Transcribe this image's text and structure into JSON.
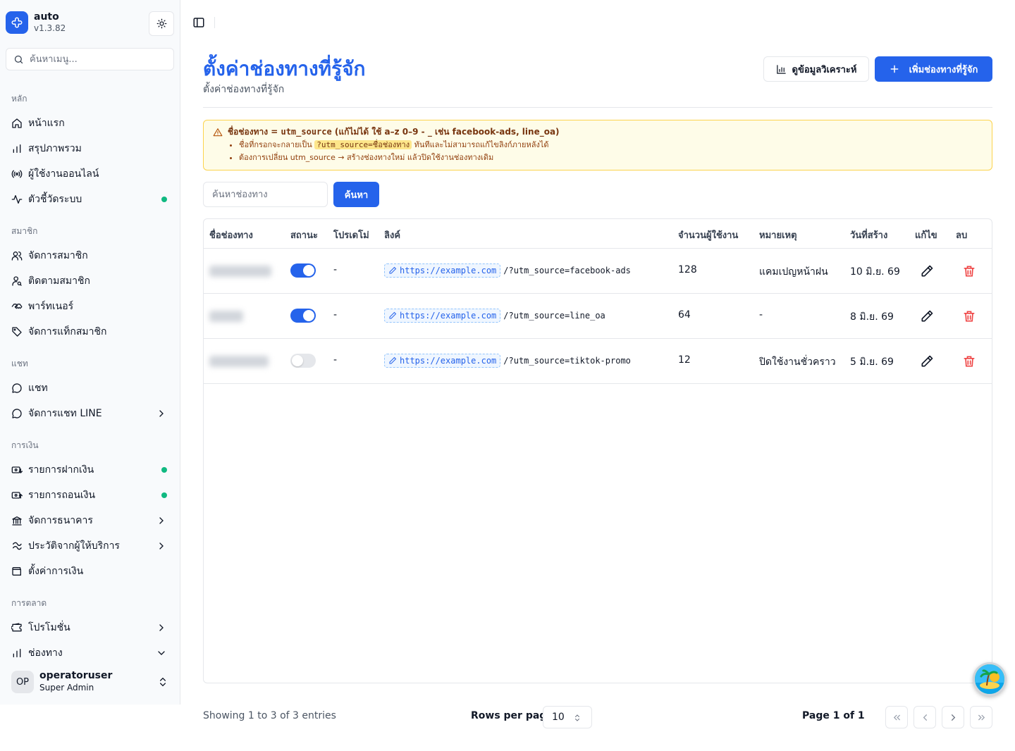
{
  "app": {
    "name": "auto",
    "version": "v1.3.82"
  },
  "sidebar": {
    "search_placeholder": "ค้นหาเมนู...",
    "groups": [
      {
        "label": "หลัก",
        "items": [
          {
            "label": "หน้าแรก",
            "icon": "home-icon"
          },
          {
            "label": "สรุปภาพรวม",
            "icon": "bar-chart-icon"
          },
          {
            "label": "ผู้ใช้งานออนไลน์",
            "icon": "radio-icon"
          },
          {
            "label": "ตัวชี้วัดระบบ",
            "icon": "activity-icon",
            "status": "online"
          }
        ]
      },
      {
        "label": "สมาชิก",
        "items": [
          {
            "label": "จัดการสมาชิก",
            "icon": "users-icon"
          },
          {
            "label": "ติดตามสมาชิก",
            "icon": "user-search-icon"
          },
          {
            "label": "พาร์ทเนอร์",
            "icon": "handshake-icon"
          },
          {
            "label": "จัดการแท็กสมาชิก",
            "icon": "tag-icon"
          }
        ]
      },
      {
        "label": "แชท",
        "items": [
          {
            "label": "แชท",
            "icon": "chat-icon"
          },
          {
            "label": "จัดการแชท LINE",
            "icon": "chat-icon",
            "chevron": "right"
          }
        ]
      },
      {
        "label": "การเงิน",
        "items": [
          {
            "label": "รายการฝากเงิน",
            "icon": "deposit-icon",
            "status": "online"
          },
          {
            "label": "รายการถอนเงิน",
            "icon": "withdraw-icon",
            "status": "online"
          },
          {
            "label": "จัดการธนาคาร",
            "icon": "bank-icon",
            "chevron": "right"
          },
          {
            "label": "ประวัติจากผู้ให้บริการ",
            "icon": "transfer-icon",
            "chevron": "right"
          },
          {
            "label": "ตั้งค่าการเงิน",
            "icon": "wallet-icon"
          }
        ]
      },
      {
        "label": "การตลาด",
        "items": [
          {
            "label": "โปรโมชั่น",
            "icon": "ticket-icon",
            "chevron": "right"
          },
          {
            "label": "ช่องทาง",
            "icon": "bar-chart-icon",
            "chevron": "down"
          }
        ]
      }
    ],
    "user": {
      "initials": "OP",
      "name": "operatoruser",
      "role": "Super Admin"
    }
  },
  "page": {
    "title": "ตั้งค่าช่องทางที่รู้จัก",
    "subtitle": "ตั้งค่าช่องทางที่รู้จัก",
    "analytics_button": "ดูข้อมูลวิเคราะห์",
    "add_button": "เพิ่มช่องทางที่รู้จัก"
  },
  "alert": {
    "title_prefix": "ชื่อช่องทาง = ",
    "title_code": "utm_source",
    "title_suffix": " (แก้ไม่ได้ ใช้ a–z 0–9 - _ เช่น facebook-ads, line_oa)",
    "line1_prefix": "ชื่อที่กรอกจะกลายเป็น ",
    "line1_code": "?utm_source=ชื่อช่องทาง",
    "line1_suffix": " ทันทีและไม่สามารถแก้ไขลิงก์ภายหลังได้",
    "line2": "ต้องการเปลี่ยน utm_source → สร้างช่องทางใหม่ แล้วปิดใช้งานช่องทางเดิม"
  },
  "search": {
    "placeholder": "ค้นหาช่องทาง",
    "button": "ค้นหา"
  },
  "table": {
    "columns": [
      "ชื่อช่องทาง",
      "สถานะ",
      "โปรเดโม่",
      "ลิงค์",
      "จำนวนผู้ใช้งาน",
      "หมายเหตุ",
      "วันที่สร้าง",
      "แก้ไข",
      "ลบ"
    ],
    "rows": [
      {
        "active": true,
        "promo": "-",
        "base_url": "https://example.com",
        "path": "/?utm_source=facebook-ads",
        "users": "128",
        "note": "แคมเปญหน้าฝน",
        "created": "10 มิ.ย. 69"
      },
      {
        "active": true,
        "promo": "-",
        "base_url": "https://example.com",
        "path": "/?utm_source=line_oa",
        "users": "64",
        "note": "-",
        "created": "8 มิ.ย. 69"
      },
      {
        "active": false,
        "promo": "-",
        "base_url": "https://example.com",
        "path": "/?utm_source=tiktok-promo",
        "users": "12",
        "note": "ปิดใช้งานชั่วคราว",
        "created": "5 มิ.ย. 69"
      }
    ]
  },
  "footer": {
    "showing": "Showing 1 to 3 of 3 entries",
    "rows_per_page_label": "Rows per page",
    "rows_per_page_value": "10",
    "page_label": "Page 1 of 1"
  },
  "colors": {
    "accent": "#2563eb",
    "online": "#10b981",
    "danger": "#ef4444",
    "warning_bg": "#fefce8"
  }
}
